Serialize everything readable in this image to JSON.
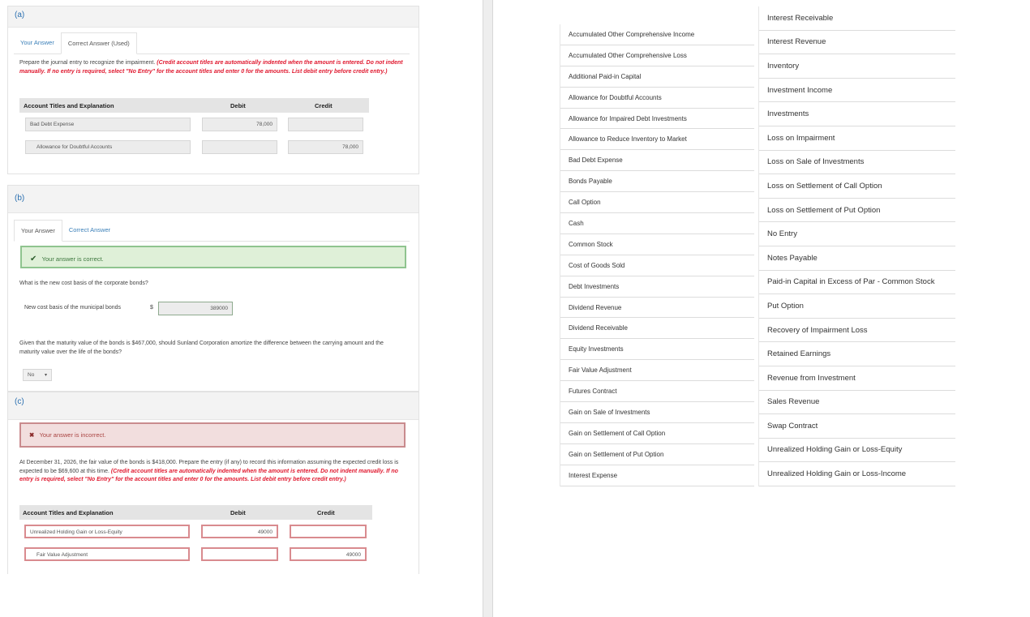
{
  "a": {
    "label": "(a)",
    "tabs": [
      "Your Answer",
      "Correct Answer (Used)"
    ],
    "instr": "Prepare the journal entry to recognize the impairment.",
    "instr_red": "(Credit account titles are automatically indented when the amount is entered. Do not indent manually. If no entry is required, select \"No Entry\" for the account titles and enter 0 for the amounts. List debit entry before credit entry.)",
    "headers": [
      "Account Titles and Explanation",
      "Debit",
      "Credit"
    ],
    "rows": [
      {
        "account": "Bad Debt Expense",
        "debit": "78,000",
        "credit": ""
      },
      {
        "account": "Allowance for Doubtful Accounts",
        "debit": "",
        "credit": "78,000"
      }
    ]
  },
  "b": {
    "label": "(b)",
    "tabs": [
      "Your Answer",
      "Correct Answer"
    ],
    "status": "Your answer is correct.",
    "q1": "What is the new cost basis of the corporate bonds?",
    "field_label": "New cost basis of the municipal bonds",
    "currency": "$",
    "field_value": "389000",
    "q2": "Given that the maturity value of the bonds is $467,000, should Sunland Corporation amortize the difference between the carrying amount and the maturity value over the life of the bonds?",
    "select_value": "No"
  },
  "c": {
    "label": "(c)",
    "status": "Your answer is incorrect.",
    "instr": "At December 31, 2026, the fair value of the bonds is $418,000. Prepare the entry (if any) to record this information assuming the expected credit loss is expected to be $69,600 at this time.",
    "instr_red": "(Credit account titles are automatically indented when the amount is entered. Do not indent manually. If no entry is required, select \"No Entry\" for the account titles and enter 0 for the amounts. List debit entry before credit entry.)",
    "headers": [
      "Account Titles and Explanation",
      "Debit",
      "Credit"
    ],
    "rows": [
      {
        "account": "Unrealized Holding Gain or Loss-Equity",
        "debit": "49000",
        "credit": ""
      },
      {
        "account": "Fair Value Adjustment",
        "debit": "",
        "credit": "49000"
      }
    ]
  },
  "accounts_col1": [
    "Accumulated Other Comprehensive Income",
    "Accumulated Other Comprehensive Loss",
    "Additional Paid-in Capital",
    "Allowance for Doubtful Accounts",
    "Allowance for Impaired Debt Investments",
    "Allowance to Reduce Inventory to Market",
    "Bad Debt Expense",
    "Bonds Payable",
    "Call Option",
    "Cash",
    "Common Stock",
    "Cost of Goods Sold",
    "Debt Investments",
    "Dividend Revenue",
    "Dividend Receivable",
    "Equity Investments",
    "Fair Value Adjustment",
    "Futures Contract",
    "Gain on Sale of Investments",
    "Gain on Settlement of Call Option",
    "Gain on Settlement of Put Option",
    "Interest Expense"
  ],
  "accounts_col2": [
    "Interest Receivable",
    "Interest Revenue",
    "Inventory",
    "Investment Income",
    "Investments",
    "Loss on Impairment",
    "Loss on Sale of Investments",
    "Loss on Settlement of Call Option",
    "Loss on Settlement of Put Option",
    "No Entry",
    "Notes Payable",
    "Paid-in Capital in Excess of Par - Common Stock",
    "Put Option",
    "Recovery of Impairment Loss",
    "Retained Earnings",
    "Revenue from Investment",
    "Sales Revenue",
    "Swap Contract",
    "Unrealized Holding Gain or Loss-Equity",
    "Unrealized Holding Gain or Loss-Income"
  ],
  "colors": {
    "link": "#3a7fb8",
    "error": "#e0192f",
    "success_bg": "#dff0d8",
    "error_bg": "#f2dede"
  }
}
